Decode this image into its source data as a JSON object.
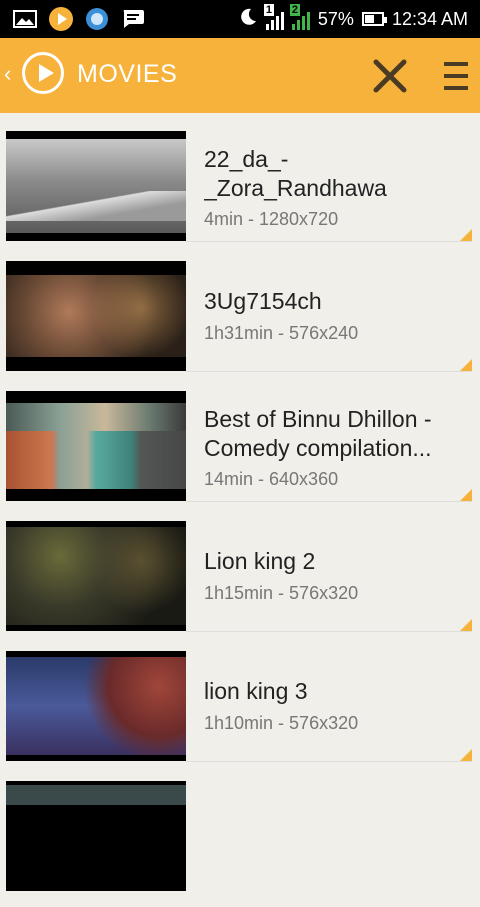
{
  "status_bar": {
    "battery": "57%",
    "time": "12:34 AM",
    "sim1": "1",
    "sim2": "2",
    "battery_level": 0.57
  },
  "app_bar": {
    "title": "MOVIES",
    "accent": "#f6b23a"
  },
  "videos": [
    {
      "title": "22_da_-_Zora_Randhawa",
      "meta": "4min - 1280x720"
    },
    {
      "title": "3Ug7154ch",
      "meta": "1h31min - 576x240"
    },
    {
      "title": "Best of Binnu Dhillon - Comedy compilation...",
      "meta": "14min - 640x360"
    },
    {
      "title": "Lion king 2",
      "meta": "1h15min - 576x320"
    },
    {
      "title": "lion king 3",
      "meta": "1h10min - 576x320"
    }
  ]
}
